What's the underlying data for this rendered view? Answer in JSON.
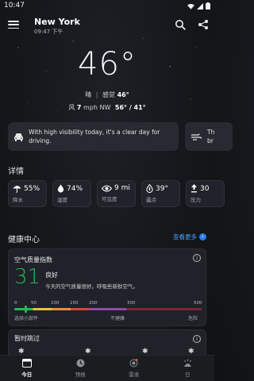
{
  "status_bar": {
    "time": "10:47"
  },
  "header": {
    "city": "New York",
    "updated": "09:47 下午"
  },
  "current": {
    "temperature": "46°",
    "condition": "晴",
    "separator": "|",
    "feels_like_label": "感觉",
    "feels_like": "46°",
    "wind_label": "风",
    "wind_speed": "7",
    "wind_unit": "mph NW",
    "high_low": "56° / 41°"
  },
  "tips": [
    {
      "icon": "car-icon",
      "text": "With high visibility today, it's a clear day for driving."
    },
    {
      "icon": "wind-icon",
      "text": "Th br"
    }
  ],
  "details": {
    "title": "详情",
    "items": [
      {
        "icon": "umbrella-icon",
        "value": "55%",
        "label": "降水"
      },
      {
        "icon": "droplet-icon",
        "value": "74%",
        "label": "湿度"
      },
      {
        "icon": "eye-icon",
        "value": "9 mi",
        "label": "可见度"
      },
      {
        "icon": "dewpoint-icon",
        "value": "39°",
        "label": "露点"
      },
      {
        "icon": "pressure-icon",
        "value": "30",
        "label": "压力"
      }
    ]
  },
  "health": {
    "title": "健康中心",
    "see_more": "查看更多",
    "aqi": {
      "title": "空气质量指数",
      "value": "31",
      "level": "良好",
      "description": "今天的空气质量很好。呼吸些新鲜空气。",
      "scale": [
        "0",
        "50",
        "100",
        "150",
        "200",
        "300",
        "500"
      ],
      "scale_labels": [
        "选择小部件",
        "不健康",
        "危险"
      ],
      "level_fraction": 0.062
    },
    "pollen": {
      "title": "暂时跳过"
    }
  },
  "bottom_nav": [
    {
      "icon": "today-icon",
      "label": "今日",
      "active": true
    },
    {
      "icon": "forecast-icon",
      "label": "预报",
      "active": false
    },
    {
      "icon": "radar-icon",
      "label": "雷達",
      "active": false
    },
    {
      "icon": "sun-icon",
      "label": "日",
      "active": false
    }
  ],
  "colors": {
    "accent": "#4d9df8",
    "aqi_good": "#23b95a",
    "card": "#272a30"
  }
}
